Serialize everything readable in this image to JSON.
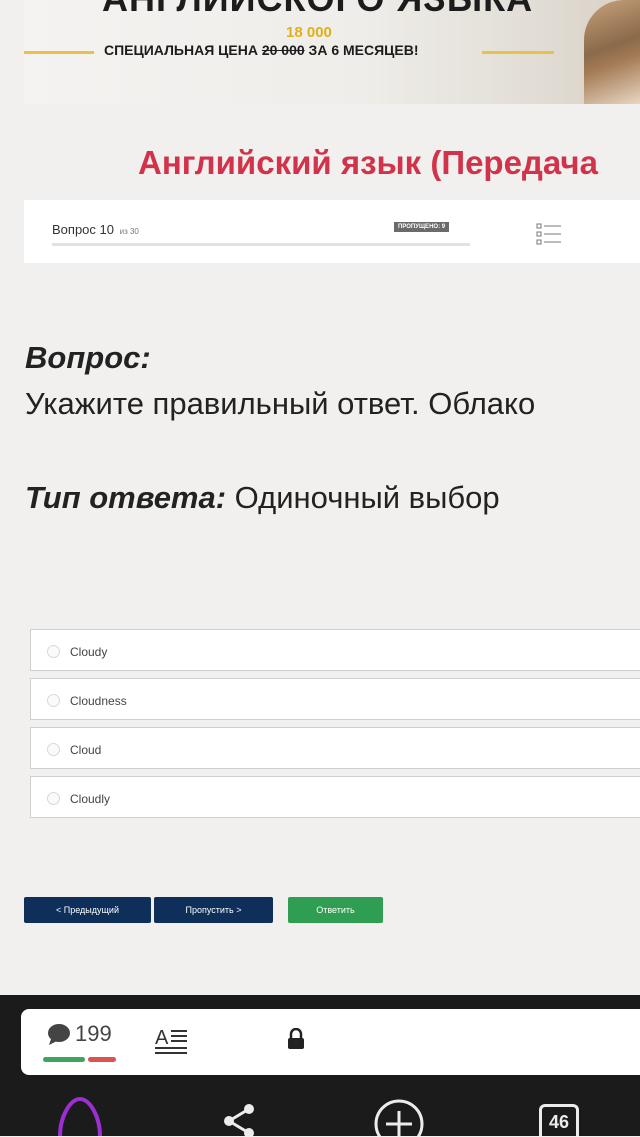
{
  "banner": {
    "heading": "АНГЛИЙСКОГО ЯЗЫКА",
    "new_price": "18 000",
    "offer_prefix": "СПЕЦИАЛЬНАЯ ЦЕНА",
    "old_price": "20 000",
    "offer_suffix": "ЗА 6 МЕСЯЦЕВ!"
  },
  "quiz": {
    "title": "Английский язык (Передача",
    "question_label": "Вопрос 10",
    "question_of": "из 30",
    "skipped_badge": "ПРОПУЩЕНО: 9",
    "progress_fraction": 0.3
  },
  "question": {
    "heading": "Вопрос:",
    "text": "Укажите правильный ответ. Облако",
    "answer_type_label": "Тип ответа:",
    "answer_type_value": " Одиночный выбор"
  },
  "options": [
    {
      "label": "Cloudy"
    },
    {
      "label": "Cloudness"
    },
    {
      "label": "Cloud"
    },
    {
      "label": "Cloudly"
    }
  ],
  "buttons": {
    "prev": "< Предыдущий",
    "skip": "Пропустить >",
    "answer": "Ответить"
  },
  "actions": {
    "comment_count": "199",
    "rating_positive_fraction": 0.6
  },
  "navbar": {
    "tabs_count": "46"
  },
  "colors": {
    "title": "#d0334a",
    "primary_button": "#0d2f5a",
    "answer_button": "#2f9e52",
    "banner_accent": "#e0b019"
  }
}
